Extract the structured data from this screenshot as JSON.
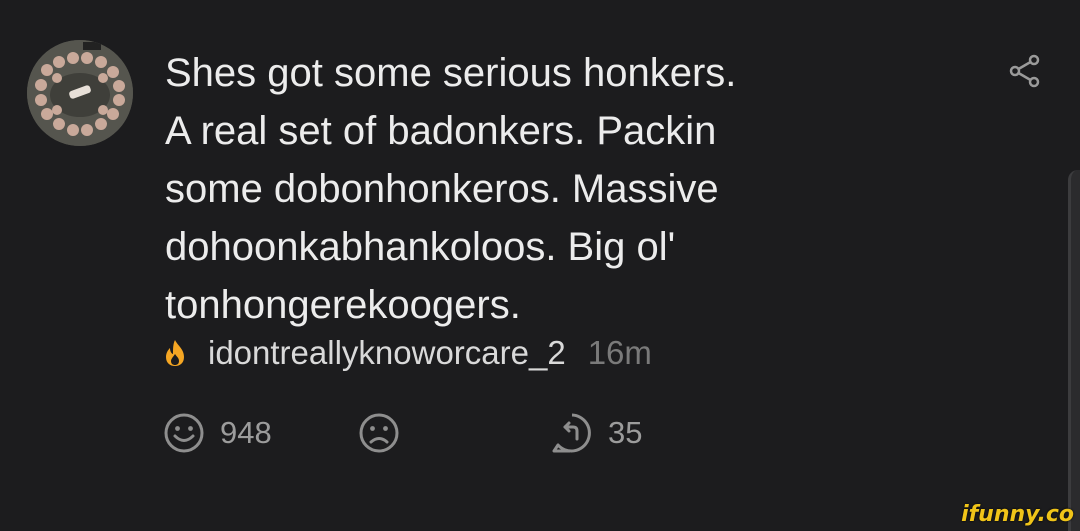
{
  "comment": {
    "text": "Shes got some serious honkers.\nA real set of badonkers. Packin\nsome dobonhonkeros. Massive\ndohoonkabhankoloos. Big ol'\ntonhongerekoogers.",
    "username": "idontreallyknoworcare_2",
    "time": "16m",
    "badge_icon": "flame-icon",
    "badge_color": "#f5a623"
  },
  "actions": {
    "like_count": "948",
    "dislike_count": "",
    "reply_count": "35"
  },
  "watermark": "ifunny.co"
}
